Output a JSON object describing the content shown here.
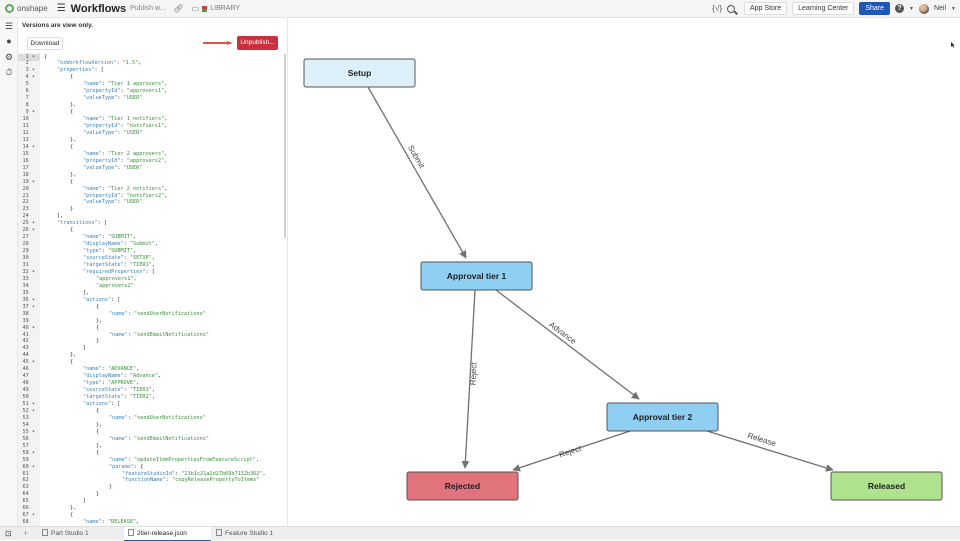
{
  "topbar": {
    "brand": "onshape",
    "doc_title": "Workflows",
    "doc_subtitle": "Publish w...",
    "library_label": "LIBRARY",
    "app_store": "App Store",
    "learning_center": "Learning Center",
    "share": "Share",
    "help": "?",
    "user_name": "Neil",
    "vars_icon_text": "{√}"
  },
  "editor": {
    "versions_message": "Versions are view only.",
    "download_label": "Download",
    "unpublish_label": "Unpublish...",
    "lines": [
      {
        "n": "1",
        "fold": true,
        "indent": 0,
        "parts": [
          [
            "p",
            "{"
          ]
        ]
      },
      {
        "n": "2",
        "indent": 1,
        "parts": [
          [
            "k",
            "\"osWorkflowVersion\""
          ],
          [
            "p",
            ": "
          ],
          [
            "s",
            "\"1.5\""
          ],
          [
            "p",
            ","
          ]
        ]
      },
      {
        "n": "3",
        "fold": true,
        "indent": 1,
        "parts": [
          [
            "k",
            "\"properties\""
          ],
          [
            "p",
            ": ["
          ]
        ]
      },
      {
        "n": "4",
        "fold": true,
        "indent": 2,
        "parts": [
          [
            "p",
            "{"
          ]
        ]
      },
      {
        "n": "5",
        "indent": 3,
        "parts": [
          [
            "k",
            "\"name\""
          ],
          [
            "p",
            ": "
          ],
          [
            "s",
            "\"Tier 1 approvers\""
          ],
          [
            "p",
            ","
          ]
        ]
      },
      {
        "n": "6",
        "indent": 3,
        "parts": [
          [
            "k",
            "\"propertyId\""
          ],
          [
            "p",
            ": "
          ],
          [
            "s",
            "\"approvers1\""
          ],
          [
            "p",
            ","
          ]
        ]
      },
      {
        "n": "7",
        "indent": 3,
        "parts": [
          [
            "k",
            "\"valueType\""
          ],
          [
            "p",
            ": "
          ],
          [
            "s",
            "\"USER\""
          ]
        ]
      },
      {
        "n": "8",
        "indent": 2,
        "parts": [
          [
            "p",
            "},"
          ]
        ]
      },
      {
        "n": "9",
        "fold": true,
        "indent": 2,
        "parts": [
          [
            "p",
            "{"
          ]
        ]
      },
      {
        "n": "10",
        "indent": 3,
        "parts": [
          [
            "k",
            "\"name\""
          ],
          [
            "p",
            ": "
          ],
          [
            "s",
            "\"Tier 1 notifiers\""
          ],
          [
            "p",
            ","
          ]
        ]
      },
      {
        "n": "11",
        "indent": 3,
        "parts": [
          [
            "k",
            "\"propertyId\""
          ],
          [
            "p",
            ": "
          ],
          [
            "s",
            "\"notifiers1\""
          ],
          [
            "p",
            ","
          ]
        ]
      },
      {
        "n": "12",
        "indent": 3,
        "parts": [
          [
            "k",
            "\"valueType\""
          ],
          [
            "p",
            ": "
          ],
          [
            "s",
            "\"USER\""
          ]
        ]
      },
      {
        "n": "13",
        "indent": 2,
        "parts": [
          [
            "p",
            "},"
          ]
        ]
      },
      {
        "n": "14",
        "fold": true,
        "indent": 2,
        "parts": [
          [
            "p",
            "{"
          ]
        ]
      },
      {
        "n": "15",
        "indent": 3,
        "parts": [
          [
            "k",
            "\"name\""
          ],
          [
            "p",
            ": "
          ],
          [
            "s",
            "\"Tier 2 approvers\""
          ],
          [
            "p",
            ","
          ]
        ]
      },
      {
        "n": "16",
        "indent": 3,
        "parts": [
          [
            "k",
            "\"propertyId\""
          ],
          [
            "p",
            ": "
          ],
          [
            "s",
            "\"approvers2\""
          ],
          [
            "p",
            ","
          ]
        ]
      },
      {
        "n": "17",
        "indent": 3,
        "parts": [
          [
            "k",
            "\"valueType\""
          ],
          [
            "p",
            ": "
          ],
          [
            "s",
            "\"USER\""
          ]
        ]
      },
      {
        "n": "18",
        "indent": 2,
        "parts": [
          [
            "p",
            "},"
          ]
        ]
      },
      {
        "n": "19",
        "fold": true,
        "indent": 2,
        "parts": [
          [
            "p",
            "{"
          ]
        ]
      },
      {
        "n": "20",
        "indent": 3,
        "parts": [
          [
            "k",
            "\"name\""
          ],
          [
            "p",
            ": "
          ],
          [
            "s",
            "\"Tier 2 notifiers\""
          ],
          [
            "p",
            ","
          ]
        ]
      },
      {
        "n": "21",
        "indent": 3,
        "parts": [
          [
            "k",
            "\"propertyId\""
          ],
          [
            "p",
            ": "
          ],
          [
            "s",
            "\"notifiers2\""
          ],
          [
            "p",
            ","
          ]
        ]
      },
      {
        "n": "22",
        "indent": 3,
        "parts": [
          [
            "k",
            "\"valueType\""
          ],
          [
            "p",
            ": "
          ],
          [
            "s",
            "\"USER\""
          ]
        ]
      },
      {
        "n": "23",
        "indent": 2,
        "parts": [
          [
            "p",
            "}"
          ]
        ]
      },
      {
        "n": "24",
        "indent": 1,
        "parts": [
          [
            "p",
            "],"
          ]
        ]
      },
      {
        "n": "25",
        "fold": true,
        "indent": 1,
        "parts": [
          [
            "k",
            "\"transitions\""
          ],
          [
            "p",
            ": ["
          ]
        ]
      },
      {
        "n": "26",
        "fold": true,
        "indent": 2,
        "parts": [
          [
            "p",
            "{"
          ]
        ]
      },
      {
        "n": "27",
        "indent": 3,
        "parts": [
          [
            "k",
            "\"name\""
          ],
          [
            "p",
            ": "
          ],
          [
            "s",
            "\"SUBMIT\""
          ],
          [
            "p",
            ","
          ]
        ]
      },
      {
        "n": "28",
        "indent": 3,
        "parts": [
          [
            "k",
            "\"displayName\""
          ],
          [
            "p",
            ": "
          ],
          [
            "s",
            "\"Submit\""
          ],
          [
            "p",
            ","
          ]
        ]
      },
      {
        "n": "29",
        "indent": 3,
        "parts": [
          [
            "k",
            "\"type\""
          ],
          [
            "p",
            ": "
          ],
          [
            "s",
            "\"SUBMIT\""
          ],
          [
            "p",
            ","
          ]
        ]
      },
      {
        "n": "30",
        "indent": 3,
        "parts": [
          [
            "k",
            "\"sourceState\""
          ],
          [
            "p",
            ": "
          ],
          [
            "s",
            "\"SETUP\""
          ],
          [
            "p",
            ","
          ]
        ]
      },
      {
        "n": "31",
        "indent": 3,
        "parts": [
          [
            "k",
            "\"targetState\""
          ],
          [
            "p",
            ": "
          ],
          [
            "s",
            "\"TIER1\""
          ],
          [
            "p",
            ","
          ]
        ]
      },
      {
        "n": "32",
        "fold": true,
        "indent": 3,
        "parts": [
          [
            "k",
            "\"requiredProperties\""
          ],
          [
            "p",
            ": ["
          ]
        ]
      },
      {
        "n": "33",
        "indent": 4,
        "parts": [
          [
            "s",
            "\"approvers1\""
          ],
          [
            "p",
            ","
          ]
        ]
      },
      {
        "n": "34",
        "indent": 4,
        "parts": [
          [
            "s",
            "\"approvers2\""
          ]
        ]
      },
      {
        "n": "35",
        "indent": 3,
        "parts": [
          [
            "p",
            "],"
          ]
        ]
      },
      {
        "n": "36",
        "fold": true,
        "indent": 3,
        "parts": [
          [
            "k",
            "\"actions\""
          ],
          [
            "p",
            ": ["
          ]
        ]
      },
      {
        "n": "37",
        "fold": true,
        "indent": 4,
        "parts": [
          [
            "p",
            "{"
          ]
        ]
      },
      {
        "n": "38",
        "indent": 5,
        "parts": [
          [
            "k",
            "\"name\""
          ],
          [
            "p",
            ": "
          ],
          [
            "s",
            "\"sendUserNotifications\""
          ]
        ]
      },
      {
        "n": "39",
        "indent": 4,
        "parts": [
          [
            "p",
            "},"
          ]
        ]
      },
      {
        "n": "40",
        "fold": true,
        "indent": 4,
        "parts": [
          [
            "p",
            "{"
          ]
        ]
      },
      {
        "n": "41",
        "indent": 5,
        "parts": [
          [
            "k",
            "\"name\""
          ],
          [
            "p",
            ": "
          ],
          [
            "s",
            "\"sendEmailNotifications\""
          ]
        ]
      },
      {
        "n": "42",
        "indent": 4,
        "parts": [
          [
            "p",
            "}"
          ]
        ]
      },
      {
        "n": "43",
        "indent": 3,
        "parts": [
          [
            "p",
            "]"
          ]
        ]
      },
      {
        "n": "44",
        "indent": 2,
        "parts": [
          [
            "p",
            "},"
          ]
        ]
      },
      {
        "n": "45",
        "fold": true,
        "indent": 2,
        "parts": [
          [
            "p",
            "{"
          ]
        ]
      },
      {
        "n": "46",
        "indent": 3,
        "parts": [
          [
            "k",
            "\"name\""
          ],
          [
            "p",
            ": "
          ],
          [
            "s",
            "\"ADVANCE\""
          ],
          [
            "p",
            ","
          ]
        ]
      },
      {
        "n": "47",
        "indent": 3,
        "parts": [
          [
            "k",
            "\"displayName\""
          ],
          [
            "p",
            ": "
          ],
          [
            "s",
            "\"Advance\""
          ],
          [
            "p",
            ","
          ]
        ]
      },
      {
        "n": "48",
        "indent": 3,
        "parts": [
          [
            "k",
            "\"type\""
          ],
          [
            "p",
            ": "
          ],
          [
            "s",
            "\"APPROVE\""
          ],
          [
            "p",
            ","
          ]
        ]
      },
      {
        "n": "49",
        "indent": 3,
        "parts": [
          [
            "k",
            "\"sourceState\""
          ],
          [
            "p",
            ": "
          ],
          [
            "s",
            "\"TIER1\""
          ],
          [
            "p",
            ","
          ]
        ]
      },
      {
        "n": "50",
        "indent": 3,
        "parts": [
          [
            "k",
            "\"targetState\""
          ],
          [
            "p",
            ": "
          ],
          [
            "s",
            "\"TIER2\""
          ],
          [
            "p",
            ","
          ]
        ]
      },
      {
        "n": "51",
        "fold": true,
        "indent": 3,
        "parts": [
          [
            "k",
            "\"actions\""
          ],
          [
            "p",
            ": ["
          ]
        ]
      },
      {
        "n": "52",
        "fold": true,
        "indent": 4,
        "parts": [
          [
            "p",
            "{"
          ]
        ]
      },
      {
        "n": "53",
        "indent": 5,
        "parts": [
          [
            "k",
            "\"name\""
          ],
          [
            "p",
            ": "
          ],
          [
            "s",
            "\"sendUserNotifications\""
          ]
        ]
      },
      {
        "n": "54",
        "indent": 4,
        "parts": [
          [
            "p",
            "},"
          ]
        ]
      },
      {
        "n": "55",
        "fold": true,
        "indent": 4,
        "parts": [
          [
            "p",
            "{"
          ]
        ]
      },
      {
        "n": "56",
        "indent": 5,
        "parts": [
          [
            "k",
            "\"name\""
          ],
          [
            "p",
            ": "
          ],
          [
            "s",
            "\"sendEmailNotifications\""
          ]
        ]
      },
      {
        "n": "57",
        "indent": 4,
        "parts": [
          [
            "p",
            "},"
          ]
        ]
      },
      {
        "n": "58",
        "fold": true,
        "indent": 4,
        "parts": [
          [
            "p",
            "{"
          ]
        ]
      },
      {
        "n": "59",
        "indent": 5,
        "parts": [
          [
            "k",
            "\"name\""
          ],
          [
            "p",
            ": "
          ],
          [
            "s",
            "\"updateItemPropertiesFromFeatureScript\""
          ],
          [
            "p",
            ","
          ]
        ]
      },
      {
        "n": "60",
        "fold": true,
        "indent": 5,
        "parts": [
          [
            "k",
            "\"params\""
          ],
          [
            "p",
            ": {"
          ]
        ]
      },
      {
        "n": "61",
        "indent": 6,
        "parts": [
          [
            "k",
            "\"featureStudioId\""
          ],
          [
            "p",
            ": "
          ],
          [
            "s",
            "\"21b1c21a2d27b69b7132b362\""
          ],
          [
            "p",
            ","
          ]
        ]
      },
      {
        "n": "62",
        "indent": 6,
        "parts": [
          [
            "k",
            "\"functionName\""
          ],
          [
            "p",
            ": "
          ],
          [
            "s",
            "\"copyReleasePropertyToItems\""
          ]
        ]
      },
      {
        "n": "63",
        "indent": 5,
        "parts": [
          [
            "p",
            "}"
          ]
        ]
      },
      {
        "n": "64",
        "indent": 4,
        "parts": [
          [
            "p",
            "}"
          ]
        ]
      },
      {
        "n": "65",
        "indent": 3,
        "parts": [
          [
            "p",
            "]"
          ]
        ]
      },
      {
        "n": "66",
        "indent": 2,
        "parts": [
          [
            "p",
            "},"
          ]
        ]
      },
      {
        "n": "67",
        "fold": true,
        "indent": 2,
        "parts": [
          [
            "p",
            "{"
          ]
        ]
      },
      {
        "n": "68",
        "indent": 3,
        "parts": [
          [
            "k",
            "\"name\""
          ],
          [
            "p",
            ": "
          ],
          [
            "s",
            "\"RELEASE\""
          ],
          [
            "p",
            ","
          ]
        ]
      }
    ]
  },
  "diagram": {
    "nodes": [
      {
        "id": "setup",
        "label": "Setup",
        "color": "#dcf0fa"
      },
      {
        "id": "tier1",
        "label": "Approval tier 1",
        "color": "#8ecff2"
      },
      {
        "id": "tier2",
        "label": "Approval tier 2",
        "color": "#8ecff2"
      },
      {
        "id": "rejected",
        "label": "Rejected",
        "color": "#e0737b"
      },
      {
        "id": "released",
        "label": "Released",
        "color": "#aee28c"
      }
    ],
    "edges": [
      {
        "from": "setup",
        "to": "tier1",
        "label": "Submit"
      },
      {
        "from": "tier1",
        "to": "tier2",
        "label": "Advance"
      },
      {
        "from": "tier1",
        "to": "rejected",
        "label": "Reject"
      },
      {
        "from": "tier2",
        "to": "rejected",
        "label": "Reject"
      },
      {
        "from": "tier2",
        "to": "released",
        "label": "Release"
      }
    ]
  },
  "bottom_tabs": [
    {
      "label": "Part Studio 1",
      "active": false
    },
    {
      "label": "2tier-release.json",
      "active": true
    },
    {
      "label": "Feature Studio 1",
      "active": false
    }
  ],
  "colors": {
    "accent_share": "#1e57b8",
    "unpublish": "#c9303c",
    "code_key": "#3b80b8",
    "code_string": "#3b8e3b"
  }
}
